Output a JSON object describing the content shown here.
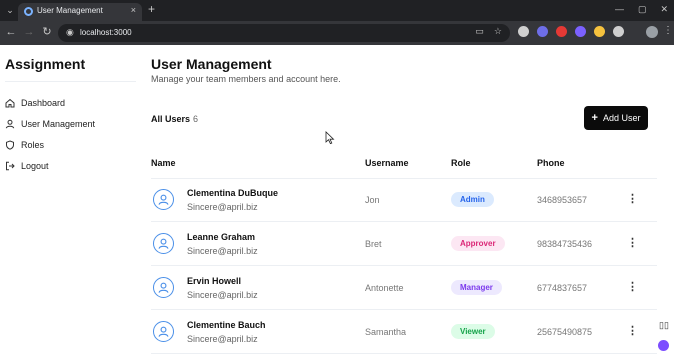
{
  "browser": {
    "tab_title": "User Management",
    "url": "localhost:3000",
    "tab_menu_icon": "chevron-down",
    "new_tab_symbol": "+",
    "tab_close_symbol": "×",
    "extension_colors": [
      "#cfcfcf",
      "#6e6ee8",
      "#e53935",
      "#7b61ff",
      "#f6c23e",
      "#cfcfcf"
    ]
  },
  "sidebar": {
    "brand": "Assignment",
    "items": [
      {
        "label": "Dashboard",
        "icon": "home-icon"
      },
      {
        "label": "User Management",
        "icon": "user-icon"
      },
      {
        "label": "Roles",
        "icon": "shield-icon"
      },
      {
        "label": "Logout",
        "icon": "logout-icon"
      }
    ]
  },
  "main": {
    "title": "User Management",
    "subtitle": "Manage your team members and account here.",
    "all_users_label": "All Users",
    "user_count": "6",
    "add_button_label": "Add User",
    "columns": [
      "Name",
      "Username",
      "Role",
      "Phone"
    ],
    "users": [
      {
        "name": "Clementina DuBuque",
        "email": "Sincere@april.biz",
        "username": "Jon",
        "role": "Admin",
        "phone": "3468953657"
      },
      {
        "name": "Leanne Graham",
        "email": "Sincere@april.biz",
        "username": "Bret",
        "role": "Approver",
        "phone": "98384735436"
      },
      {
        "name": "Ervin Howell",
        "email": "Sincere@april.biz",
        "username": "Antonette",
        "role": "Manager",
        "phone": "6774837657"
      },
      {
        "name": "Clementine Bauch",
        "email": "Sincere@april.biz",
        "username": "Samantha",
        "role": "Viewer",
        "phone": "25675490875"
      }
    ]
  },
  "role_colors": {
    "Admin": {
      "bg": "#dbeafe",
      "fg": "#2563eb"
    },
    "Approver": {
      "bg": "#fce7f3",
      "fg": "#db2777"
    },
    "Manager": {
      "bg": "#ede9fe",
      "fg": "#7c3aed"
    },
    "Viewer": {
      "bg": "#dcfce7",
      "fg": "#16a34a"
    }
  }
}
